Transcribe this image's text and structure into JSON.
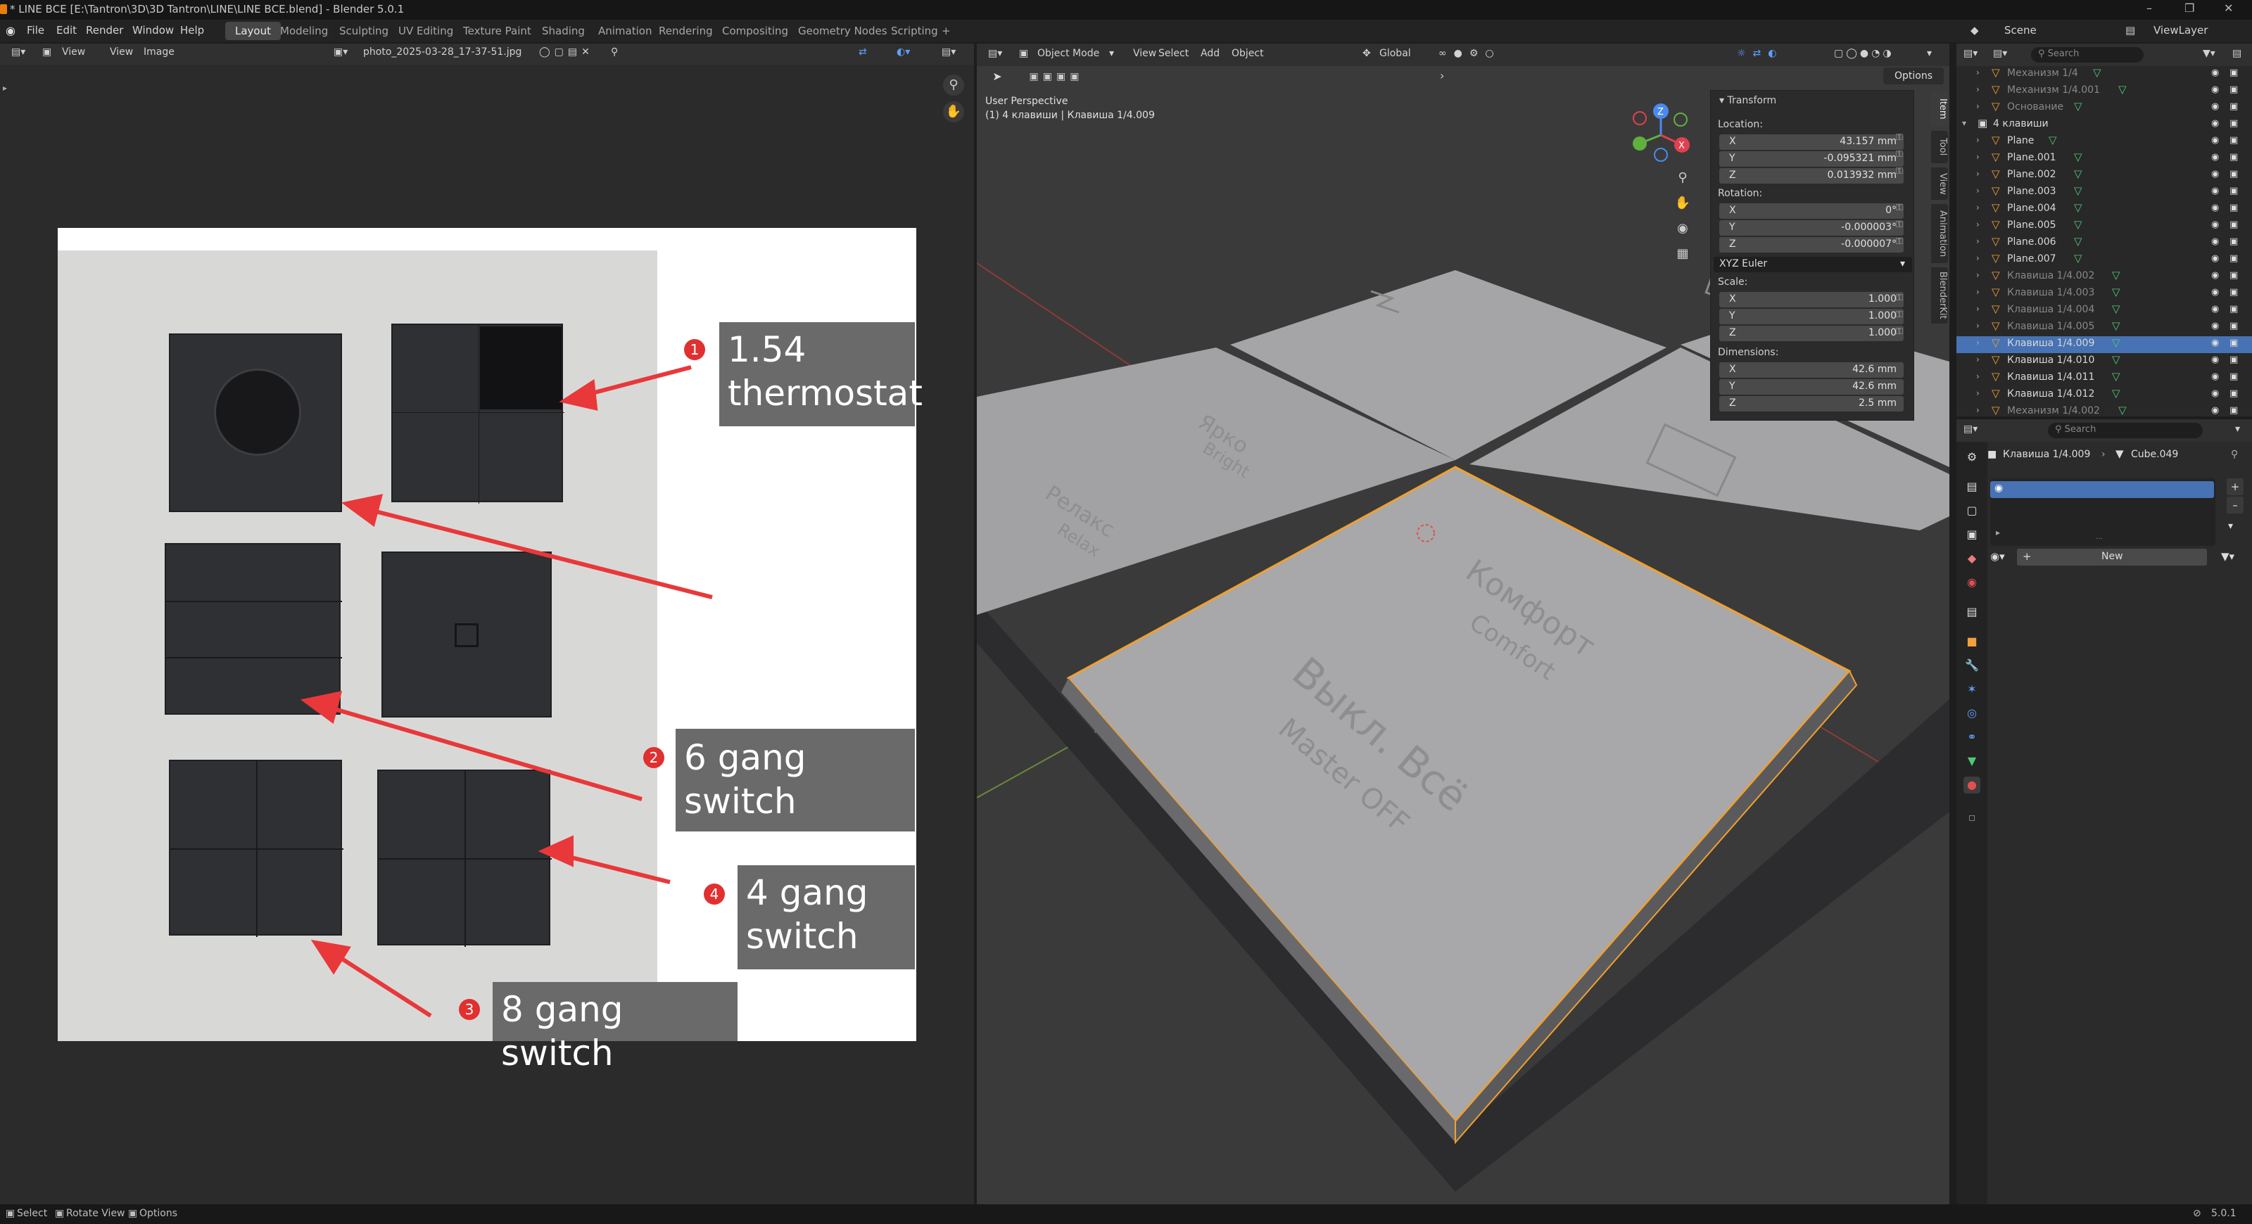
{
  "window": {
    "title": "* LINE ВСЕ [E:\\Tantron\\3D\\3D Tantron\\LINE\\LINE ВСЕ.blend] - Blender 5.0.1"
  },
  "menus": [
    "File",
    "Edit",
    "Render",
    "Window",
    "Help"
  ],
  "workspaces": [
    {
      "label": "Layout",
      "active": true
    },
    {
      "label": "Modeling"
    },
    {
      "label": "Sculpting"
    },
    {
      "label": "UV Editing"
    },
    {
      "label": "Texture Paint"
    },
    {
      "label": "Shading"
    },
    {
      "label": "Animation"
    },
    {
      "label": "Rendering"
    },
    {
      "label": "Compositing"
    },
    {
      "label": "Geometry Nodes"
    },
    {
      "label": "Scripting"
    }
  ],
  "scene": {
    "label": "Scene",
    "view_layer": "ViewLayer"
  },
  "image_editor": {
    "view_menu": "View",
    "view2": "View",
    "image_menu": "Image",
    "image_name": "photo_2025-03-28_17-37-51.jpg",
    "callouts": [
      {
        "badge": "1",
        "line1": "1.54",
        "line2": "thermostat"
      },
      {
        "badge": "2",
        "line1": "6 gang switch",
        "line2": ""
      },
      {
        "badge": "4",
        "line1": "4 gang",
        "line2": "switch"
      },
      {
        "badge": "3",
        "line1": "8 gang switch",
        "line2": ""
      }
    ]
  },
  "viewport": {
    "mode": "Object Mode",
    "menus": [
      "View",
      "Select",
      "Add",
      "Object"
    ],
    "orientation": "Global",
    "options_label": "Options",
    "perspective": "User Perspective",
    "context": "(1) 4 клавиши | Клавиша 1/4.009",
    "key_labels": {
      "tl_ru": "Релакс",
      "tl_en": "Relax",
      "tm_ru": "Ярко",
      "tm_en": "Bright",
      "comfort_ru": "Комфорт",
      "comfort_en": "Comfort",
      "off_ru": "Выкл. Всё",
      "off_en": "Master OFF"
    },
    "n_tabs": [
      "Item",
      "Tool",
      "View",
      "Animation",
      "BlenderKit"
    ],
    "transform": {
      "header": "Transform",
      "location_label": "Location:",
      "location": {
        "x": "43.157 mm",
        "y": "-0.095321 mm",
        "z": "0.013932 mm"
      },
      "rotation_label": "Rotation:",
      "rotation": {
        "x": "0°",
        "y": "-0.000003°",
        "z": "-0.000007°"
      },
      "rotation_mode": "XYZ Euler",
      "scale_label": "Scale:",
      "scale": {
        "x": "1.000",
        "y": "1.000",
        "z": "1.000"
      },
      "dimensions_label": "Dimensions:",
      "dimensions": {
        "x": "42.6 mm",
        "y": "42.6 mm",
        "z": "2.5 mm"
      }
    }
  },
  "outliner": {
    "search_placeholder": "Search",
    "rows": [
      {
        "name": "Механизм 1/4",
        "indent": 1,
        "dim": true
      },
      {
        "name": "Механизм 1/4.001",
        "indent": 1,
        "dim": true
      },
      {
        "name": "Основание",
        "indent": 1,
        "dim": true
      },
      {
        "name": "4 клавиши",
        "indent": 0,
        "collection": true
      },
      {
        "name": "Plane",
        "indent": 1
      },
      {
        "name": "Plane.001",
        "indent": 1
      },
      {
        "name": "Plane.002",
        "indent": 1
      },
      {
        "name": "Plane.003",
        "indent": 1
      },
      {
        "name": "Plane.004",
        "indent": 1
      },
      {
        "name": "Plane.005",
        "indent": 1
      },
      {
        "name": "Plane.006",
        "indent": 1
      },
      {
        "name": "Plane.007",
        "indent": 1
      },
      {
        "name": "Клавиша 1/4.002",
        "indent": 1,
        "dim": true
      },
      {
        "name": "Клавиша 1/4.003",
        "indent": 1,
        "dim": true
      },
      {
        "name": "Клавиша 1/4.004",
        "indent": 1,
        "dim": true
      },
      {
        "name": "Клавиша 1/4.005",
        "indent": 1,
        "dim": true
      },
      {
        "name": "Клавиша 1/4.009",
        "indent": 1,
        "selected": true
      },
      {
        "name": "Клавиша 1/4.010",
        "indent": 1
      },
      {
        "name": "Клавиша 1/4.011",
        "indent": 1
      },
      {
        "name": "Клавиша 1/4.012",
        "indent": 1
      },
      {
        "name": "Механизм 1/4.002",
        "indent": 1,
        "dim": true
      }
    ]
  },
  "properties": {
    "search_placeholder": "Search",
    "object": "Клавиша 1/4.009",
    "mesh": "Cube.049",
    "new_label": "New"
  },
  "status": {
    "select": "Select",
    "rotate": "Rotate View",
    "options": "Options",
    "version": "5.0.1"
  }
}
